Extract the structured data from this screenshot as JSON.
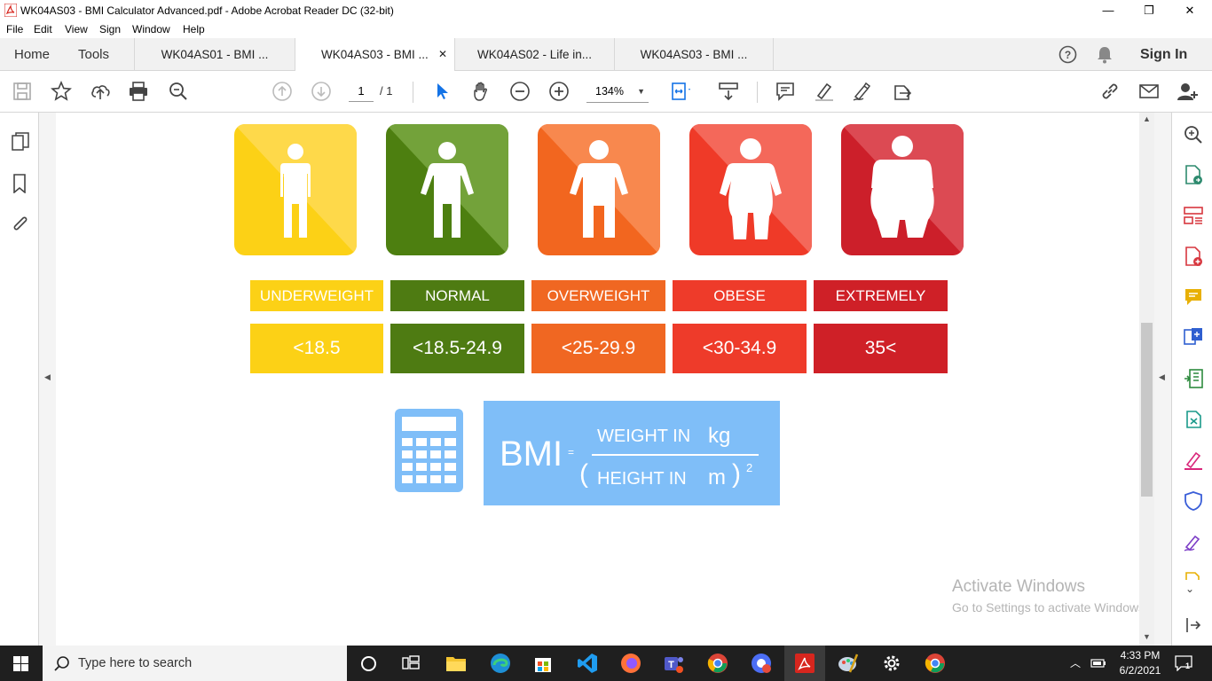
{
  "window": {
    "title": "WK04AS03 - BMI Calculator Advanced.pdf - Adobe Acrobat Reader DC (32-bit)",
    "minimize": "—",
    "maximize": "❐",
    "close": "✕"
  },
  "menu": [
    "File",
    "Edit",
    "View",
    "Sign",
    "Window",
    "Help"
  ],
  "nav": {
    "home": "Home",
    "tools": "Tools",
    "sign_in": "Sign In"
  },
  "tabs": [
    {
      "label": "WK04AS01 - BMI ..."
    },
    {
      "label": "WK04AS03 - BMI ...",
      "close": "✕"
    },
    {
      "label": "WK04AS02 - Life in..."
    },
    {
      "label": "WK04AS03 - BMI ..."
    }
  ],
  "toolbar": {
    "page_current": "1",
    "page_total": "/ 1",
    "zoom": "134%"
  },
  "document": {
    "categories": [
      {
        "name": "UNDERWEIGHT",
        "range": "<18.5",
        "color": "#fcd116",
        "box": "#fcd116",
        "figure": "#fed94a"
      },
      {
        "name": "NORMAL",
        "range": "<18.5-24.9",
        "color": "#4e7b12",
        "box": "#4d7f10",
        "figure": "#73a23a"
      },
      {
        "name": "OVERWEIGHT",
        "range": "<25-29.9",
        "color": "#f06722",
        "box": "#f2661f",
        "figure": "#f8884e"
      },
      {
        "name": "OBESE",
        "range": "<30-34.9",
        "color": "#ee3b2a",
        "box": "#ef3a28",
        "figure": "#f4685a"
      },
      {
        "name": "EXTREMELY OBESE",
        "range": "35<",
        "color": "#cf2027",
        "box": "#cc1f2a",
        "figure": "#dc4a53"
      }
    ],
    "formula": {
      "bmi": "BMI",
      "equals": "=",
      "numerator_text": "WEIGHT IN",
      "numerator_unit": "kg",
      "denominator_open": "(",
      "denominator_text": "HEIGHT IN",
      "denominator_unit": "m",
      "denominator_close": ")",
      "exponent": "2",
      "box_color": "#7fbef8",
      "calc_color": "#7fbef8"
    }
  },
  "watermark": {
    "title": "Activate Windows",
    "subtitle": "Go to Settings to activate Windows."
  },
  "taskbar": {
    "search_placeholder": "Type here to search",
    "time": "4:33 PM",
    "date": "6/2/2021",
    "notifications": "1"
  }
}
